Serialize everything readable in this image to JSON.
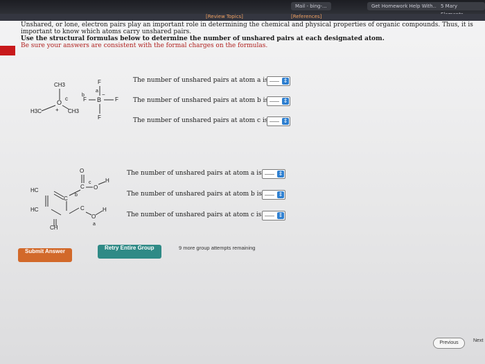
{
  "browser": {
    "tabs": [
      "Mail - bing-...",
      "Get Homework Help With...",
      "5 Mary Elements"
    ]
  },
  "toolbar": {
    "review_topics": "[Review Topics]",
    "references": "[References]"
  },
  "instructions": {
    "line1": "Unshared, or lone, electron pairs play an important role in determining the chemical and physical properties of organic compounds. Thus, it is important to know which atoms carry unshared pairs.",
    "line2": "Use the structural formulas below to determine the number of unshared pairs at each designated atom.",
    "line3": "Be sure your answers are consistent with the formal charges on the formulas."
  },
  "molecule1": {
    "labels": {
      "ch3_top": "CH3",
      "o": "O",
      "c": "c",
      "plus": "+",
      "h3c": "H3C",
      "ch3_bottom": "CH3",
      "b": "b",
      "a": "a",
      "minus": "−",
      "B": "B",
      "F_top": "F",
      "F_left": "F",
      "F_right": "F",
      "F_bottom": "F"
    },
    "questions": [
      {
        "text": "The number of unshared pairs at atom a is",
        "value": ""
      },
      {
        "text": "The number of unshared pairs at atom b is",
        "value": ""
      },
      {
        "text": "The number of unshared pairs at atom c is",
        "value": ""
      }
    ]
  },
  "molecule2": {
    "labels": {
      "o_top": "O",
      "c_top": "C",
      "c_label": "c",
      "o_right": "O",
      "h_top": "H",
      "hc1": "HC",
      "c_mid": "C",
      "b_label": "b",
      "hc2": "HC",
      "c_lower": "C",
      "o_lower": "O",
      "h_lower": "H",
      "a_label": "a",
      "ch_bottom": "CH"
    },
    "questions": [
      {
        "text": "The number of unshared pairs at atom a is",
        "value": ""
      },
      {
        "text": "The number of unshared pairs at atom b is",
        "value": ""
      },
      {
        "text": "The number of unshared pairs at atom c is",
        "value": ""
      }
    ]
  },
  "dropdown_glyph": "⇕",
  "actions": {
    "submit": "Submit Answer",
    "retry": "Retry Entire Group",
    "attempts": "9 more group attempts remaining"
  },
  "nav": {
    "previous": "Previous",
    "next": "Next"
  },
  "colors": {
    "submit_bg": "#d2692a",
    "retry_bg": "#2f8a86",
    "dropdown_blue": "#2e7fd0",
    "instruction_red": "#b0201e"
  }
}
